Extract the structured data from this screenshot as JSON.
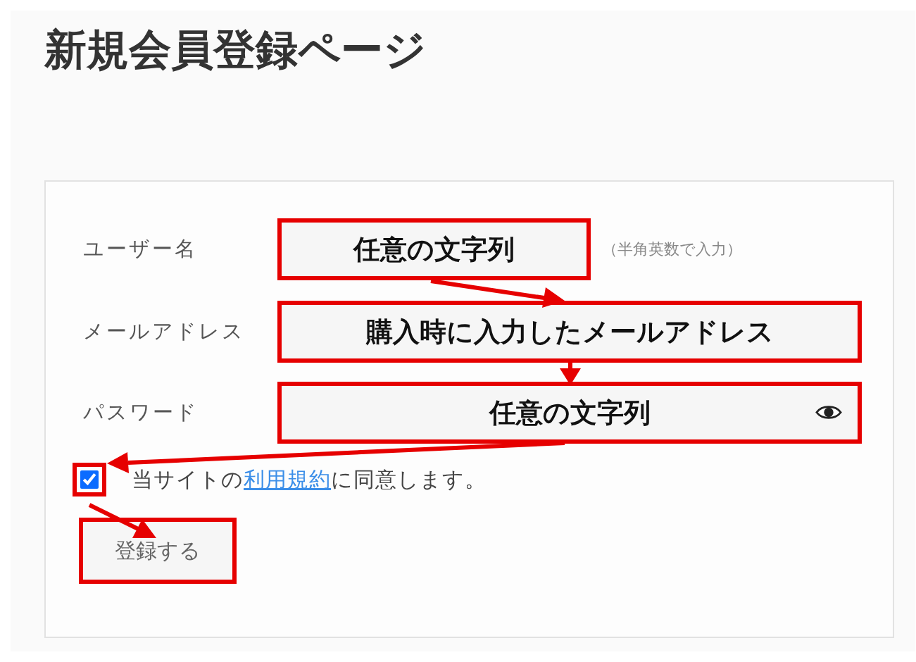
{
  "page": {
    "title": "新規会員登録ページ"
  },
  "fields": [
    {
      "label": "ユーザー名",
      "value": "任意の文字列",
      "note": "（半角英数で入力）",
      "kind": "text"
    },
    {
      "label": "メールアドレス",
      "value": "購入時に入力したメールアドレス",
      "kind": "text"
    },
    {
      "label": "パスワード",
      "value": "任意の文字列",
      "kind": "password"
    }
  ],
  "agreement": {
    "checked": true,
    "before": "当サイトの",
    "link": "利用規約",
    "after": "に同意します。"
  },
  "submit_button": "登録する"
}
